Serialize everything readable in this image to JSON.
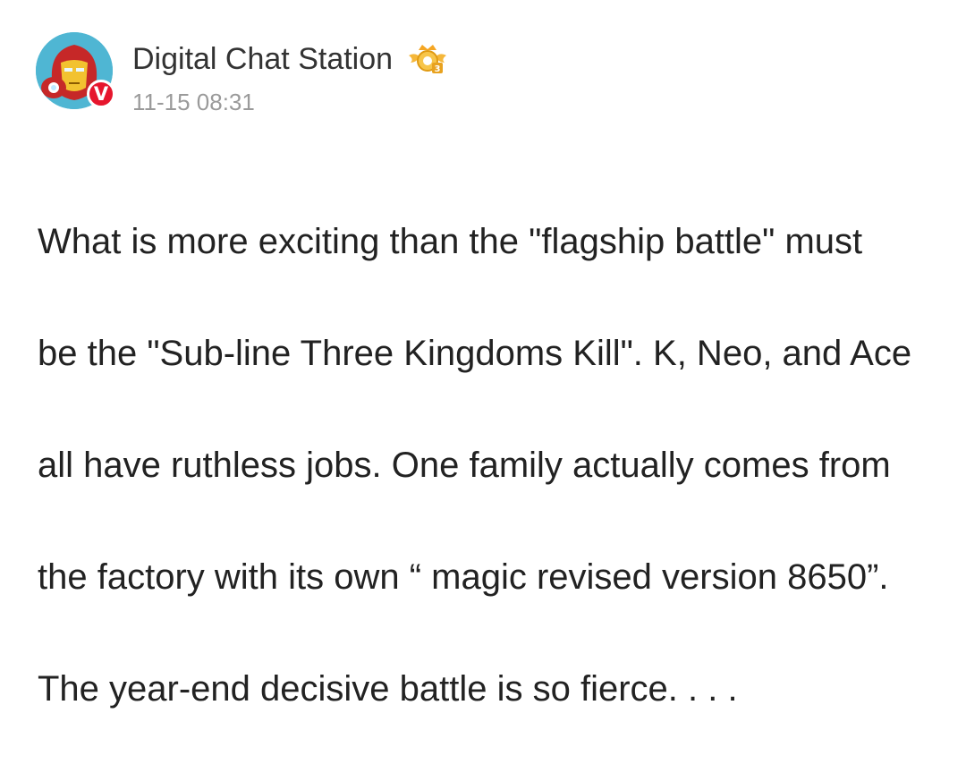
{
  "post": {
    "author": {
      "name": "Digital Chat Station",
      "verified_mark": "V",
      "avatar": "iron-man-avatar",
      "badge": "crown-badge"
    },
    "timestamp": "11-15 08:31",
    "lines": [
      "What is more exciting than the \"flagship battle\" must",
      "be the \"Sub-line Three Kingdoms Kill\". K, Neo, and Ace",
      "all have ruthless jobs. One family actually comes from",
      "the factory with its own “ magic revised version 8650”.",
      "The year-end decisive battle is so fierce. . . ."
    ]
  },
  "colors": {
    "verified_red": "#e6162d",
    "badge_gold": "#f5b73a",
    "timestamp_gray": "#9a9a9a",
    "text_dark": "#222222"
  }
}
